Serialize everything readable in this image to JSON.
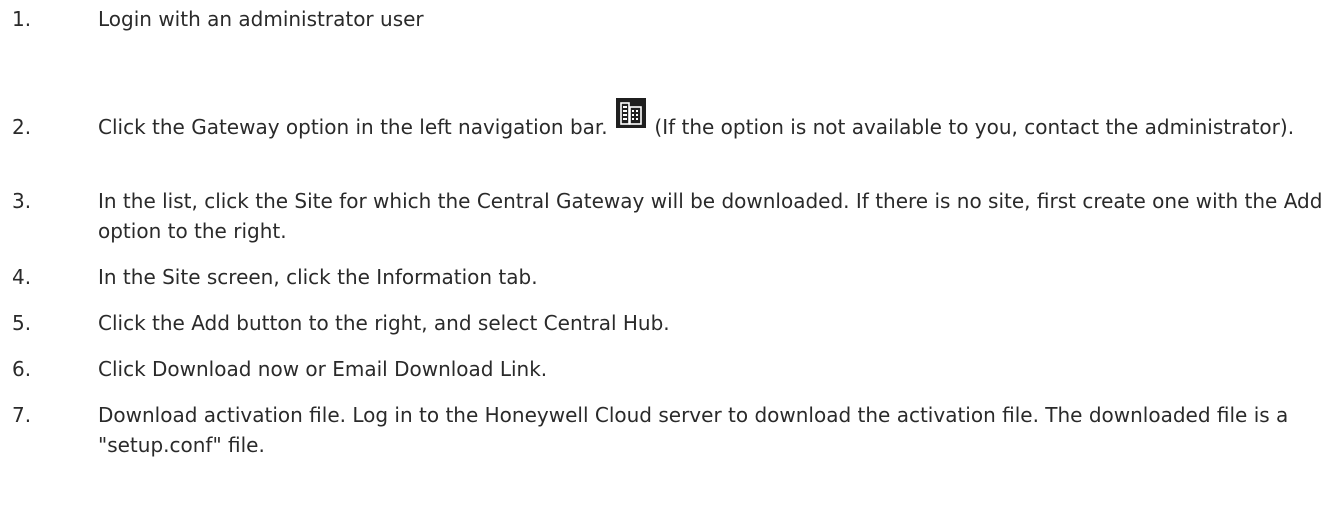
{
  "steps": [
    {
      "num": "1.",
      "text": "Login with an administrator user"
    },
    {
      "num": "2.",
      "text_before_icon": "Click the Gateway option in the left navigation bar.",
      "icon": "gateway-building-icon",
      "text_after_icon": "(If the option is not available to you, contact the administrator)."
    },
    {
      "num": "3.",
      "text": "In the list, click the Site for which the Central Gateway will be downloaded. If there is no site, first create one with the Add option to the right."
    },
    {
      "num": "4.",
      "text": "In the Site screen, click the Information tab."
    },
    {
      "num": "5.",
      "text": "Click the Add button to the right, and select Central Hub."
    },
    {
      "num": "6.",
      "text": "Click Download now or Email Download Link."
    },
    {
      "num": "7.",
      "text": "Download activation file. Log in to the Honeywell Cloud server to download the activation file. The downloaded file is a \"setup.conf\" file."
    }
  ],
  "colors": {
    "text": "#2a2a2a",
    "icon_background": "#1f1f1f",
    "icon_foreground": "#ffffff"
  }
}
